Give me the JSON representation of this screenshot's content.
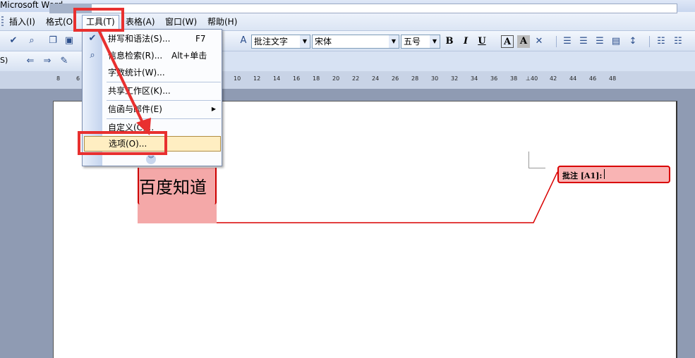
{
  "window": {
    "title": "Microsoft Word"
  },
  "menubar": {
    "items": [
      {
        "label": "插入(I)"
      },
      {
        "label": "格式(O)"
      },
      {
        "label": "工具(T)"
      },
      {
        "label": "表格(A)"
      },
      {
        "label": "窗口(W)"
      },
      {
        "label": "帮助(H)"
      }
    ]
  },
  "toolbar": {
    "style_value": "批注文字",
    "font_value": "宋体",
    "size_value": "五号",
    "bold_label": "B",
    "italic_label": "I",
    "underline_label": "U",
    "highlight_label": "A",
    "shade_label": "A",
    "partial_label": "S)"
  },
  "ruler": {
    "ticks": [
      "8",
      "6",
      "10",
      "12",
      "14",
      "16",
      "18",
      "20",
      "22",
      "24",
      "26",
      "28",
      "30",
      "32",
      "34",
      "36",
      "38",
      "40",
      "42",
      "44",
      "46",
      "48"
    ]
  },
  "tools_menu": {
    "items": [
      {
        "label": "拼写和语法(S)...",
        "shortcut": "F7",
        "icon": "spellcheck-icon"
      },
      {
        "label": "信息检索(R)...",
        "shortcut": "Alt+单击",
        "icon": "research-icon"
      },
      {
        "label": "字数统计(W)..."
      },
      {
        "label": "共享工作区(K)..."
      },
      {
        "label": "信函与邮件(E)",
        "submenu": true
      },
      {
        "label": "自定义(C)..."
      },
      {
        "label": "选项(O)..."
      }
    ]
  },
  "document": {
    "text": "百度知道",
    "comment_label": "批注 [A1]:"
  },
  "colors": {
    "annotation_red": "#e8302f",
    "comment_border": "#d90000",
    "comment_fill": "#f9b4b4",
    "menu_highlight": "#ffeec2"
  }
}
